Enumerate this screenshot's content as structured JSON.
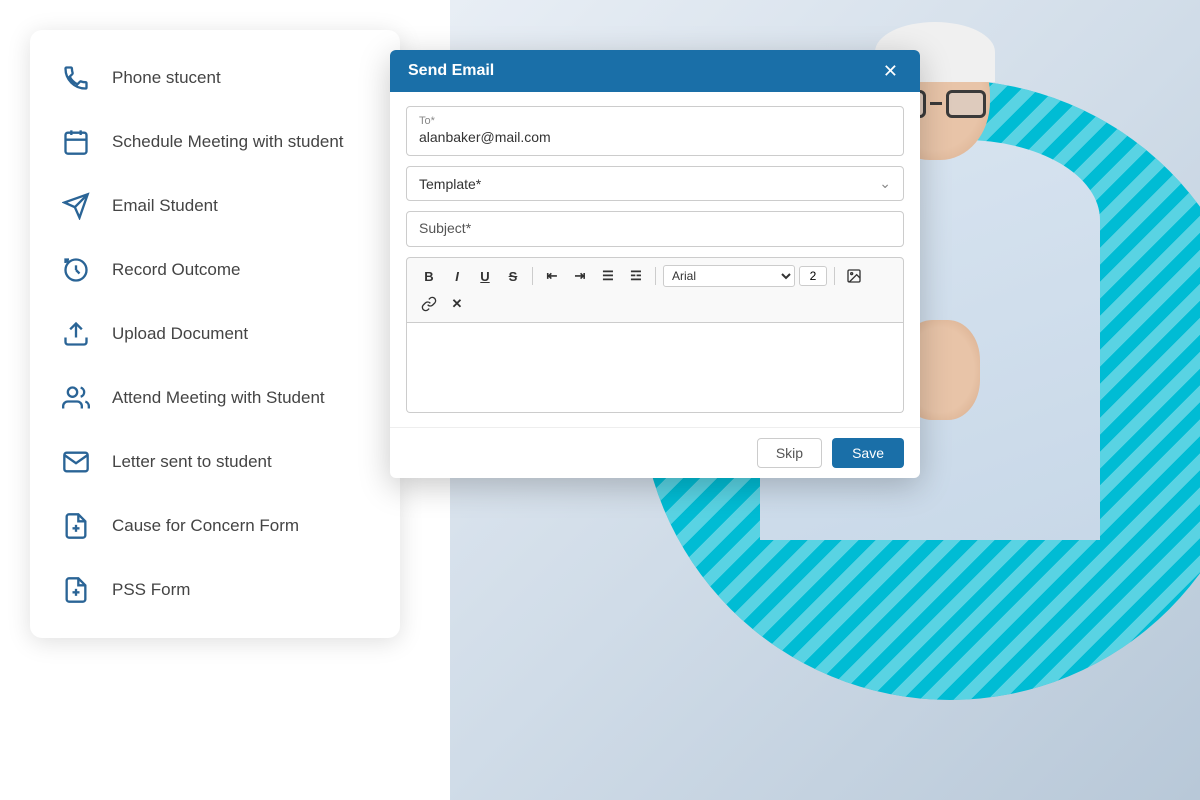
{
  "sidebar": {
    "items": [
      {
        "id": "phone-student",
        "label": "Phone stucent",
        "icon": "phone"
      },
      {
        "id": "schedule-meeting",
        "label": "Schedule Meeting with student",
        "icon": "calendar"
      },
      {
        "id": "email-student",
        "label": "Email Student",
        "icon": "email-send"
      },
      {
        "id": "record-outcome",
        "label": "Record Outcome",
        "icon": "record"
      },
      {
        "id": "upload-document",
        "label": "Upload Document",
        "icon": "upload"
      },
      {
        "id": "attend-meeting",
        "label": "Attend Meeting with Student",
        "icon": "group"
      },
      {
        "id": "letter-sent",
        "label": "Letter sent to student",
        "icon": "envelope"
      },
      {
        "id": "cause-concern",
        "label": "Cause for Concern Form",
        "icon": "form-plus"
      },
      {
        "id": "pss-form",
        "label": "PSS Form",
        "icon": "form-plus2"
      }
    ]
  },
  "email_modal": {
    "title": "Send Email",
    "to_label": "To*",
    "to_value": "alanbaker@mail.com",
    "template_placeholder": "Template*",
    "subject_placeholder": "Subject*",
    "toolbar": {
      "bold": "B",
      "italic": "I",
      "underline": "U",
      "strikethrough": "S",
      "indent": "⇤",
      "outdent": "⇥",
      "list_ul": "≡",
      "list_ol": "☰",
      "font_name": "Arial",
      "font_size": "2",
      "image": "🖼",
      "link": "🔗",
      "remove": "✕"
    },
    "skip_label": "Skip",
    "save_label": "Save"
  },
  "colors": {
    "header_bg": "#1a6fa8",
    "accent": "#00bcd4",
    "sidebar_icon": "#2a7ab8",
    "text_dark": "#444444",
    "btn_save_bg": "#1a6fa8"
  }
}
